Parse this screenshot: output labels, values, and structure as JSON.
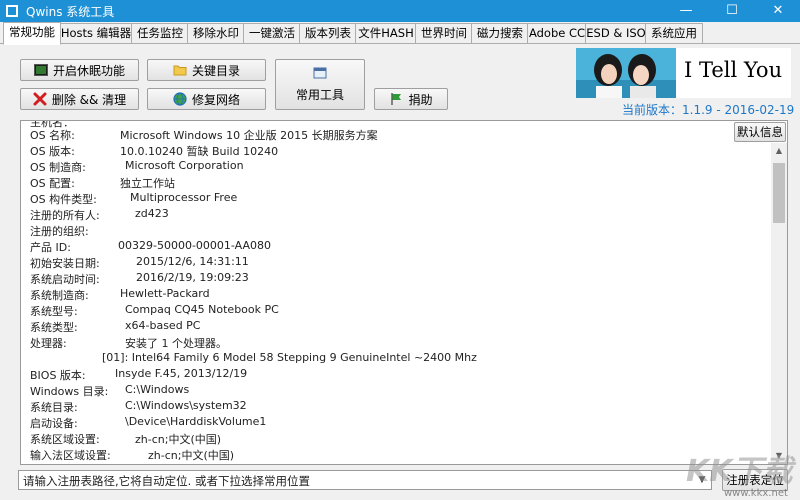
{
  "window": {
    "title": "Qwins 系统工具",
    "minimize": "—",
    "maximize": "☐",
    "close": "✕",
    "accent": "#1e90d6"
  },
  "tabs": [
    {
      "label": "常规功能",
      "active": true
    },
    {
      "label": "Hosts 编辑器"
    },
    {
      "label": "任务监控"
    },
    {
      "label": "移除水印"
    },
    {
      "label": "一键激活"
    },
    {
      "label": "版本列表"
    },
    {
      "label": "文件HASH"
    },
    {
      "label": "世界时间"
    },
    {
      "label": "磁力搜索"
    },
    {
      "label": "Adobe CC"
    },
    {
      "label": "ESD & ISO"
    },
    {
      "label": "系统应用"
    }
  ],
  "buttons": {
    "hibernate": {
      "label": "开启休眠功能",
      "icon": "terminal-icon"
    },
    "delete_clean": {
      "label": "删除 && 清理",
      "icon": "red-x-icon"
    },
    "key_dirs": {
      "label": "关键目录",
      "icon": "folder-icon"
    },
    "repair_network": {
      "label": "修复网络",
      "icon": "globe-icon"
    },
    "common_tools": {
      "label": "常用工具",
      "icon": "window-icon"
    },
    "donate": {
      "label": "捐助",
      "icon": "flag-icon"
    }
  },
  "banner": {
    "brand": "I Tell You",
    "version": "当前版本：1.1.9 - 2016-02-19"
  },
  "default_info_button": "默认信息",
  "sysinfo_partial_top": "主机名：",
  "sysinfo": [
    {
      "label": "OS 名称:",
      "value": "Microsoft Windows 10 企业版 2015 长期服务方案"
    },
    {
      "label": "OS 版本:",
      "value": "10.0.10240 暂缺 Build 10240"
    },
    {
      "label": "OS 制造商:",
      "value": "Microsoft Corporation"
    },
    {
      "label": "OS 配置:",
      "value": "独立工作站"
    },
    {
      "label": "OS 构件类型:",
      "value": "Multiprocessor Free"
    },
    {
      "label": "注册的所有人:",
      "value": "zd423"
    },
    {
      "label": "注册的组织:",
      "value": ""
    },
    {
      "label": "产品 ID:",
      "value": "00329-50000-00001-AA080"
    },
    {
      "label": "初始安装日期:",
      "value": "2015/12/6, 14:31:11"
    },
    {
      "label": "系统启动时间:",
      "value": "2016/2/19, 19:09:23"
    },
    {
      "label": "系统制造商:",
      "value": "Hewlett-Packard"
    },
    {
      "label": "系统型号:",
      "value": "Compaq CQ45 Notebook PC"
    },
    {
      "label": "系统类型:",
      "value": "x64-based PC"
    },
    {
      "label": "处理器:",
      "value": "安装了 1 个处理器。"
    },
    {
      "label": "",
      "value": "[01]: Intel64 Family 6 Model 58 Stepping 9 GenuineIntel ~2400 Mhz"
    },
    {
      "label": "BIOS 版本:",
      "value": "Insyde F.45, 2013/12/19"
    },
    {
      "label": "Windows 目录:",
      "value": "C:\\Windows"
    },
    {
      "label": "系统目录:",
      "value": "C:\\Windows\\system32"
    },
    {
      "label": "启动设备:",
      "value": "\\Device\\HarddiskVolume1"
    },
    {
      "label": "系统区域设置:",
      "value": "zh-cn;中文(中国)"
    },
    {
      "label": "输入法区域设置:",
      "value": "zh-cn;中文(中国)"
    }
  ],
  "registry_path": {
    "value": "请输入注册表路径,它将自动定位. 或者下拉选择常用位置",
    "locate_button": "注册表定位"
  },
  "watermark": {
    "big": "KK下载",
    "small": "www.kkx.net"
  }
}
